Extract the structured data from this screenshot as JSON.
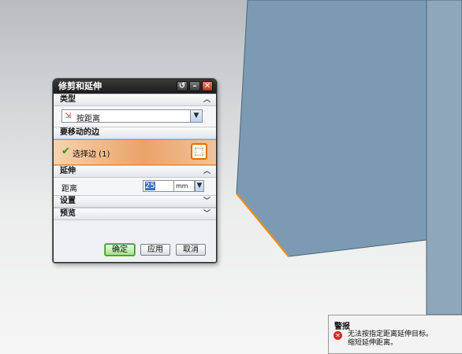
{
  "dialog": {
    "title": "修剪和延伸",
    "sections": {
      "type": {
        "label": "类型",
        "selected": "按距离"
      },
      "edge": {
        "label": "要移动的边",
        "selection": "选择边 (1)"
      },
      "extend": {
        "label": "延伸",
        "distance_label": "距离",
        "distance_value": "25",
        "unit": "mm"
      },
      "settings": {
        "label": "设置"
      },
      "preview": {
        "label": "预览"
      }
    },
    "buttons": {
      "ok": "确定",
      "apply": "应用",
      "cancel": "取消"
    }
  },
  "warning": {
    "title": "警报",
    "line1": "无法按指定距离延伸目标。",
    "line2": "缩短延伸距离。"
  },
  "colors": {
    "model_face": "#7c9bb2",
    "model_edge_highlight": "#f08a1c",
    "close_button": "#d8381f",
    "edge_row_accent": "#e9a36a"
  }
}
